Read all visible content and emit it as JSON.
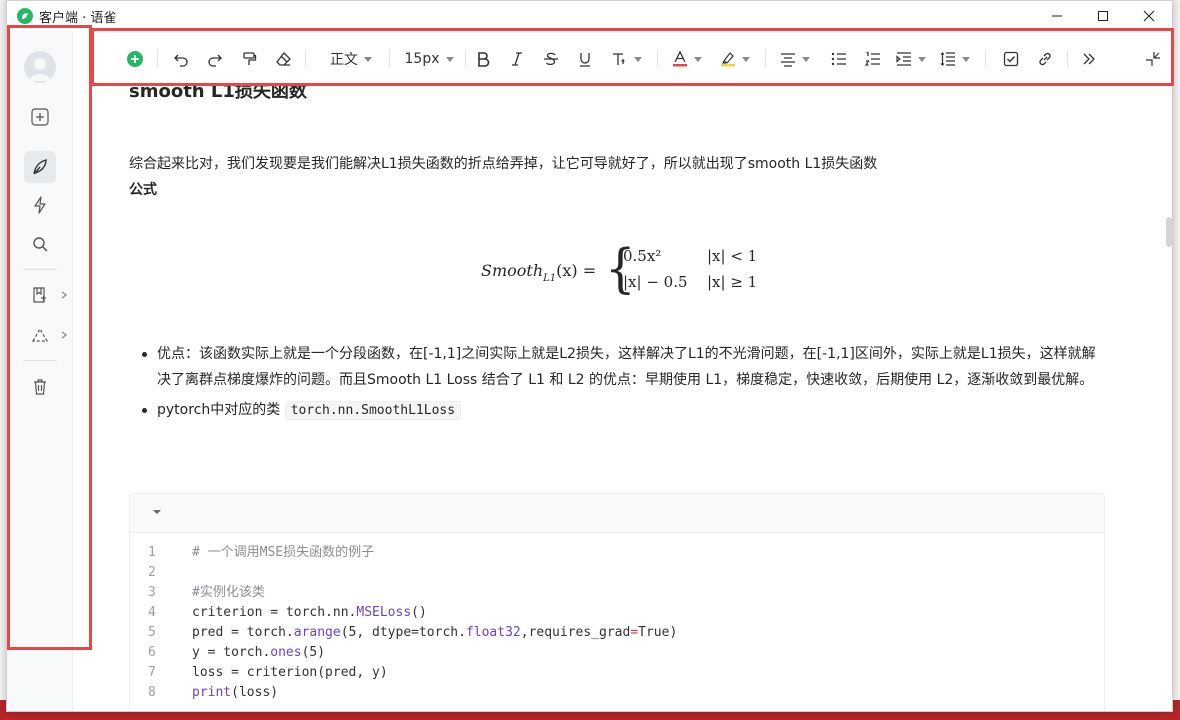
{
  "window": {
    "title": "客户端 · 语雀"
  },
  "toolbar": {
    "paragraph_style": "正文",
    "font_size": "15px",
    "icons": [
      "add-circle-icon",
      "undo-icon",
      "redo-icon",
      "format-painter-icon",
      "eraser-icon",
      "bold-icon",
      "italic-icon",
      "strikethrough-icon",
      "underline-icon",
      "text-style-icon",
      "font-color-icon",
      "highlight-icon",
      "align-icon",
      "bullet-list-icon",
      "ordered-list-icon",
      "indent-icon",
      "line-height-icon",
      "checkbox-icon",
      "link-icon",
      "more-icon",
      "collapse-icon"
    ]
  },
  "doc": {
    "heading": "smooth L1损失函数",
    "para1": "综合起来比对，我们发现要是我们能解决L1损失函数的折点给弄掉，让它可导就好了，所以就出现了smooth L1损失函数",
    "para2": "公式",
    "formula": {
      "lhs_main": "Smooth",
      "lhs_sub": "L1",
      "lhs_arg": "(x) =",
      "case1_expr": "0.5x²",
      "case1_cond": "|x| < 1",
      "case2_expr": "|x| − 0.5",
      "case2_cond": "|x| ≥ 1"
    },
    "bullet1": "优点：该函数实际上就是一个分段函数，在[-1,1]之间实际上就是L2损失，这样解决了L1的不光滑问题，在[-1,1]区间外，实际上就是L1损失，这样就解决了离群点梯度爆炸的问题。而且Smooth L1 Loss 结合了 L1 和 L2 的优点：早期使用 L1，梯度稳定，快速收敛，后期使用 L2，逐渐收敛到最优解。",
    "bullet2_prefix": "pytorch中对应的类 ",
    "bullet2_code": "torch.nn.SmoothL1Loss",
    "code_lines": [
      {
        "n": "1",
        "t": "# 一个调用MSE损失函数的例子"
      },
      {
        "n": "2",
        "t": ""
      },
      {
        "n": "3",
        "t": "#实例化该类"
      },
      {
        "n": "4",
        "t": "criterion = torch.nn.MSELoss()"
      },
      {
        "n": "5",
        "t": "pred = torch.arange(5, dtype=torch.float32,requires_grad=True)"
      },
      {
        "n": "6",
        "t": "y = torch.ones(5)"
      },
      {
        "n": "7",
        "t": "loss = criterion(pred, y)"
      },
      {
        "n": "8",
        "t": "print(loss)"
      }
    ]
  },
  "colors": {
    "accent": "#25b864",
    "annotation": "#e84747"
  }
}
